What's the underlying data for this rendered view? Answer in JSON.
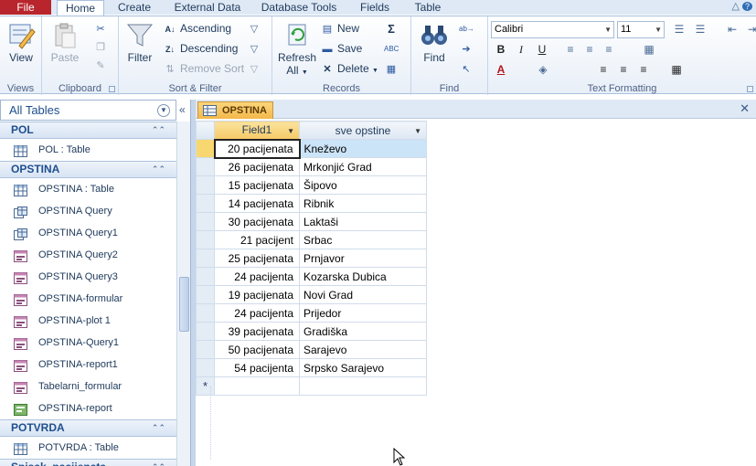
{
  "ribbon_tabs": [
    "File",
    "Home",
    "Create",
    "External Data",
    "Database Tools",
    "Fields",
    "Table"
  ],
  "active_tab": "Home",
  "groups": {
    "views": {
      "label": "Views",
      "view": "View"
    },
    "clipboard": {
      "label": "Clipboard",
      "paste": "Paste"
    },
    "sort_filter": {
      "label": "Sort & Filter",
      "filter": "Filter",
      "ascending": "Ascending",
      "descending": "Descending",
      "remove_sort": "Remove Sort"
    },
    "records": {
      "label": "Records",
      "refresh": "Refresh",
      "refresh_all": "All",
      "new": "New",
      "save": "Save",
      "delete": "Delete"
    },
    "find": {
      "label": "Find",
      "find": "Find"
    },
    "text_formatting": {
      "label": "Text Formatting",
      "font": "Calibri",
      "size": "11",
      "bold": "B",
      "italic": "I",
      "underline": "U"
    }
  },
  "nav": {
    "header": "All Tables",
    "sections": [
      {
        "title": "POL",
        "items": [
          {
            "label": "POL : Table",
            "icon": "table-icon"
          }
        ]
      },
      {
        "title": "OPSTINA",
        "items": [
          {
            "label": "OPSTINA : Table",
            "icon": "table-icon"
          },
          {
            "label": "OPSTINA Query",
            "icon": "query-icon"
          },
          {
            "label": "OPSTINA Query1",
            "icon": "query-icon"
          },
          {
            "label": "OPSTINA Query2",
            "icon": "form-icon"
          },
          {
            "label": "OPSTINA Query3",
            "icon": "form-icon"
          },
          {
            "label": "OPSTINA-formular",
            "icon": "form-icon"
          },
          {
            "label": "OPSTINA-plot 1",
            "icon": "form-icon"
          },
          {
            "label": "OPSTINA-Query1",
            "icon": "form-icon"
          },
          {
            "label": "OPSTINA-report1",
            "icon": "form-icon"
          },
          {
            "label": "Tabelarni_formular",
            "icon": "form-icon"
          },
          {
            "label": "OPSTINA-report",
            "icon": "report-icon"
          }
        ]
      },
      {
        "title": "POTVRDA",
        "items": [
          {
            "label": "POTVRDA : Table",
            "icon": "table-icon"
          }
        ]
      },
      {
        "title": "Spisak_pacijenata",
        "items": []
      }
    ]
  },
  "document": {
    "tab": "OPSTINA",
    "columns": [
      "Field1",
      "sve opstine"
    ],
    "rows": [
      [
        "20 pacijenata",
        "Kneževo"
      ],
      [
        "26 pacijenata",
        "Mrkonjić Grad"
      ],
      [
        "15 pacijenata",
        "Šipovo"
      ],
      [
        "14 pacijenata",
        "Ribnik"
      ],
      [
        "30 pacijenata",
        "Laktaši"
      ],
      [
        "21 pacijent",
        "Srbac"
      ],
      [
        "25 pacijenata",
        "Prnjavor"
      ],
      [
        "24 pacijenta",
        "Kozarska Dubica"
      ],
      [
        "19 pacijenata",
        "Novi Grad"
      ],
      [
        "24 pacijenta",
        "Prijedor"
      ],
      [
        "39 pacijenata",
        "Gradiška"
      ],
      [
        "50 pacijenata",
        "Sarajevo"
      ],
      [
        "54 pacijenta",
        "Srpsko Sarajevo"
      ]
    ],
    "new_row_marker": "*"
  }
}
